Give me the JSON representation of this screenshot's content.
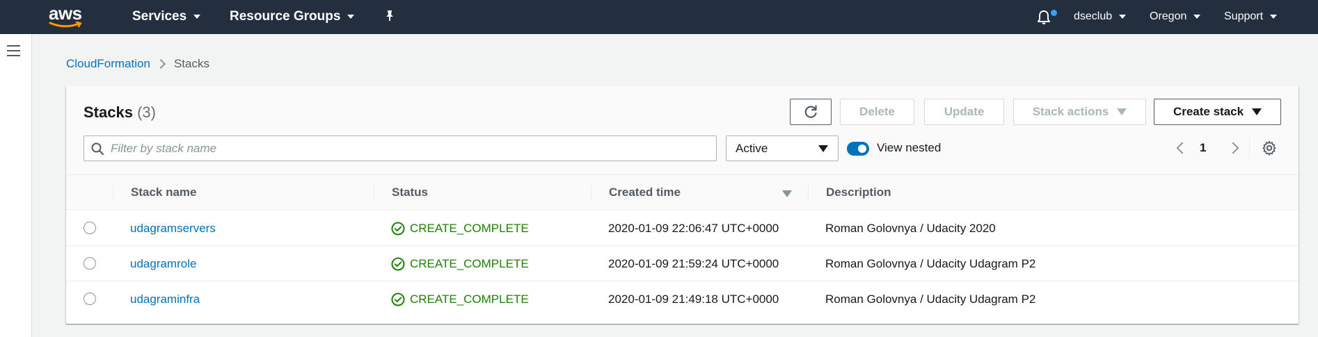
{
  "topnav": {
    "logo": "aws",
    "services": "Services",
    "resource_groups": "Resource Groups",
    "pin_icon": "pin-icon",
    "bell_icon": "bell-icon",
    "account": "dseclub",
    "region": "Oregon",
    "support": "Support"
  },
  "rail": {
    "menu_icon": "hamburger-icon"
  },
  "breadcrumb": {
    "parent": "CloudFormation",
    "current": "Stacks"
  },
  "panel": {
    "title": "Stacks",
    "count": "(3)",
    "refresh_icon": "refresh-icon",
    "delete_label": "Delete",
    "update_label": "Update",
    "stack_actions_label": "Stack actions",
    "create_stack_label": "Create stack",
    "search_placeholder": "Filter by stack name",
    "filter_value": "Active",
    "view_nested_label": "View nested",
    "page_number": "1",
    "settings_icon": "gear-icon"
  },
  "table": {
    "columns": [
      "Stack name",
      "Status",
      "Created time",
      "Description"
    ],
    "rows": [
      {
        "name": "udagramservers",
        "status": "CREATE_COMPLETE",
        "created": "2020-01-09 22:06:47 UTC+0000",
        "description": "Roman Golovnya / Udacity 2020"
      },
      {
        "name": "udagramrole",
        "status": "CREATE_COMPLETE",
        "created": "2020-01-09 21:59:24 UTC+0000",
        "description": "Roman Golovnya / Udacity Udagram P2"
      },
      {
        "name": "udagraminfra",
        "status": "CREATE_COMPLETE",
        "created": "2020-01-09 21:49:18 UTC+0000",
        "description": "Roman Golovnya / Udacity Udagram P2"
      }
    ]
  },
  "colors": {
    "nav_bg": "#232f3e",
    "link": "#0073bb",
    "success": "#1d8102",
    "aws_orange": "#ff9900"
  }
}
